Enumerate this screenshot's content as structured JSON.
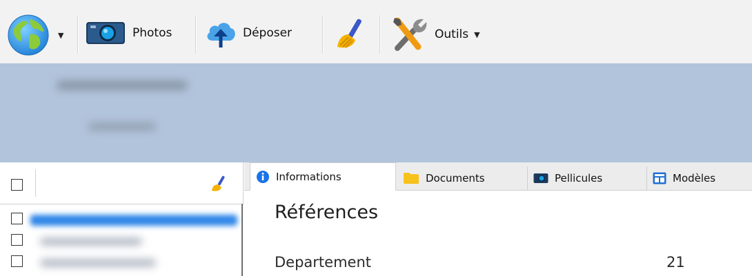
{
  "toolbar": {
    "globe_icon": "globe-icon",
    "photos_label": "Photos",
    "upload_label": "Déposer",
    "broom_icon": "broom-icon",
    "tools_label": "Outils"
  },
  "colors": {
    "band": "#b2c4dc",
    "selection": "#2f86e8",
    "info_icon": "#1a73e8",
    "folder": "#f7c21b"
  },
  "tabs": [
    {
      "label": "Informations",
      "icon": "info-icon",
      "active": true
    },
    {
      "label": "Documents",
      "icon": "folder-icon",
      "active": false
    },
    {
      "label": "Pellicules",
      "icon": "camera-icon",
      "active": false
    },
    {
      "label": "Modèles",
      "icon": "template-icon",
      "active": false
    }
  ],
  "section": {
    "title": "Références",
    "fields": [
      {
        "label": "Departement",
        "value": "21"
      }
    ]
  }
}
